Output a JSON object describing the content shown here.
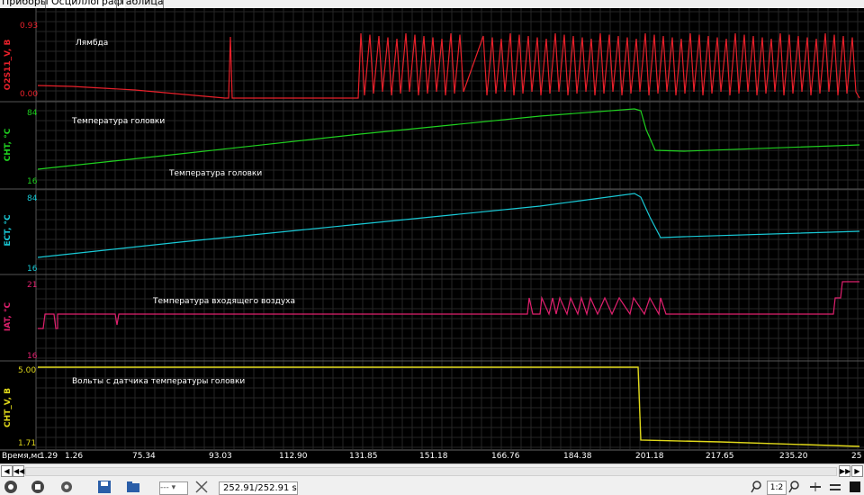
{
  "tabs": [
    {
      "label": "Приборы",
      "active": false
    },
    {
      "label": "Осциллограф",
      "active": true
    },
    {
      "label": "Таблица",
      "active": false
    }
  ],
  "channels": [
    {
      "name": "O2S11_V, В",
      "label": "Лямбда",
      "max": "0.93",
      "min": "0.00",
      "color": "#e8202a"
    },
    {
      "name": "CHT, °C",
      "label": "Температура головки",
      "max": "84",
      "min": "16",
      "color": "#1fd01f"
    },
    {
      "name": "ECT, °C",
      "label": "Температура головки",
      "max": "84",
      "min": "16",
      "color": "#19c9d6"
    },
    {
      "name": "IAT, °C",
      "label": "Температура входящего воздуха",
      "max": "21",
      "min": "16",
      "color": "#e0206e"
    },
    {
      "name": "CHT_V, В",
      "label": "Вольты с датчика температуры головки",
      "max": "5.00",
      "min": "1.71",
      "color": "#e0d81a"
    }
  ],
  "xaxis": {
    "label": "Время,мс",
    "ticks": [
      "1.29",
      "1.26",
      "75.34",
      "93.03",
      "112.90",
      "131.85",
      "151.18",
      "166.76",
      "184.38",
      "201.18",
      "217.65",
      "235.20",
      "25"
    ]
  },
  "toolbar": {
    "time_readout": "252.91/252.91 s",
    "zoom": "1:2",
    "combo": "---"
  },
  "icons": {
    "scroll_left": "triangle-left-icon",
    "scroll_right": "triangle-right-icon"
  }
}
